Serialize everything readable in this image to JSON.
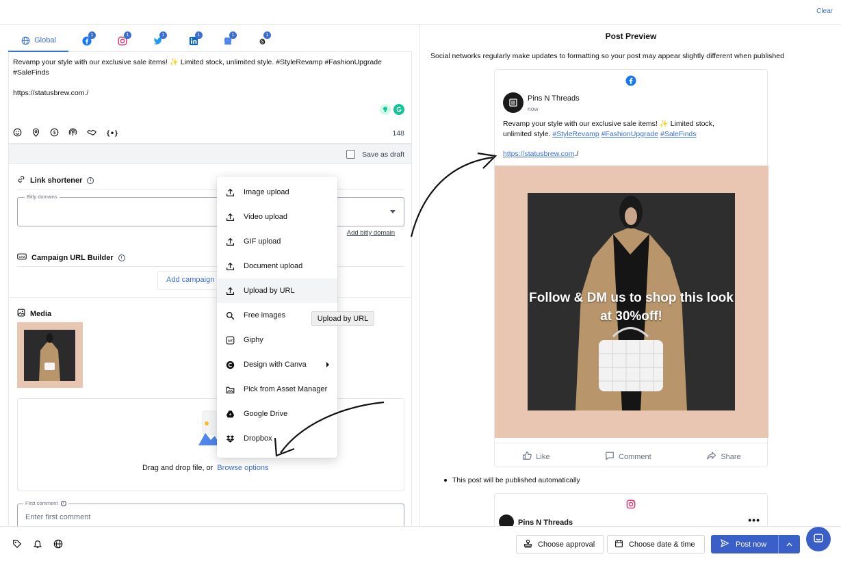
{
  "header": {
    "clear_label": "Clear"
  },
  "tabs": [
    {
      "name": "Global"
    },
    {
      "icon": "facebook-icon",
      "badge": "1"
    },
    {
      "icon": "instagram-icon",
      "badge": "1"
    },
    {
      "icon": "twitter-icon",
      "badge": "1"
    },
    {
      "icon": "linkedin-icon",
      "badge": "1"
    },
    {
      "icon": "google-business-icon",
      "badge": "1"
    },
    {
      "icon": "threads-icon",
      "badge": "1"
    }
  ],
  "editor": {
    "text": "Revamp your style with our exclusive sale items! ✨ Limited stock, unlimited style. #StyleRevamp #FashionUpgrade #SaleFinds\n\nhttps://statusbrew.com./",
    "char_count": "148",
    "tool_icons": [
      "emoji-icon",
      "location-icon",
      "dollar-icon",
      "podcast-icon",
      "handshake-icon",
      "variable-icon"
    ]
  },
  "draft": {
    "label": "Save as draft",
    "checked": false
  },
  "link_shortener": {
    "title": "Link shortener",
    "field_legend": "Bitly domains",
    "add_link": "Add bitly domain"
  },
  "campaign": {
    "title": "Campaign URL Builder",
    "button_label": "Add campaign p"
  },
  "media": {
    "title": "Media",
    "drop_text": "Drag and drop file, or",
    "browse_label": "Browse options",
    "thumb_text": "Follow & DM us to shop this look at 30%off!"
  },
  "first_comment": {
    "legend": "First comment",
    "placeholder": "Enter first comment"
  },
  "upload_menu": {
    "items": [
      {
        "label": "Image upload",
        "icon": "upload-icon"
      },
      {
        "label": "Video upload",
        "icon": "upload-icon"
      },
      {
        "label": "GIF upload",
        "icon": "upload-icon"
      },
      {
        "label": "Document upload",
        "icon": "upload-icon"
      },
      {
        "label": "Upload by URL",
        "icon": "upload-icon"
      },
      {
        "label": "Free images",
        "icon": "search-icon"
      },
      {
        "label": "Giphy",
        "icon": "giphy-icon"
      },
      {
        "label": "Design with Canva",
        "icon": "canva-icon"
      },
      {
        "label": "Pick from Asset Manager",
        "icon": "image-icon"
      },
      {
        "label": "Google Drive",
        "icon": "google-drive-icon"
      },
      {
        "label": "Dropbox",
        "icon": "dropbox-icon"
      }
    ],
    "hovered_index": 4,
    "tooltip": "Upload by URL"
  },
  "preview": {
    "title": "Post Preview",
    "note": "Social networks regularly make updates to formatting so your post may appear slightly different when published",
    "facebook_card": {
      "page_name": "Pins N Threads",
      "time": "now",
      "text_line1": "Revamp your style with our exclusive sale items! ✨ Limited stock,",
      "text_line2": "unlimited style.",
      "hashtags": [
        "#StyleRevamp",
        "#FashionUpgrade",
        "#SaleFinds"
      ],
      "link": "https://statusbrew.com",
      "link_suffix": "./",
      "overlay_text": "Follow & DM us to shop this look at 30%off!",
      "actions": [
        "Like",
        "Comment",
        "Share"
      ]
    },
    "auto_note": "This post will be published automatically",
    "instagram_card": {
      "page_name": "Pins N Threads"
    }
  },
  "footer": {
    "approval_label": "Choose approval",
    "datetime_label": "Choose date & time",
    "post_label": "Post now"
  },
  "colors": {
    "accent": "#3b6fd8",
    "primary_button": "#3b5fc9",
    "image_background": "#e9c6b2",
    "facebook": "#1877f2",
    "instagram": "#e1306c"
  }
}
